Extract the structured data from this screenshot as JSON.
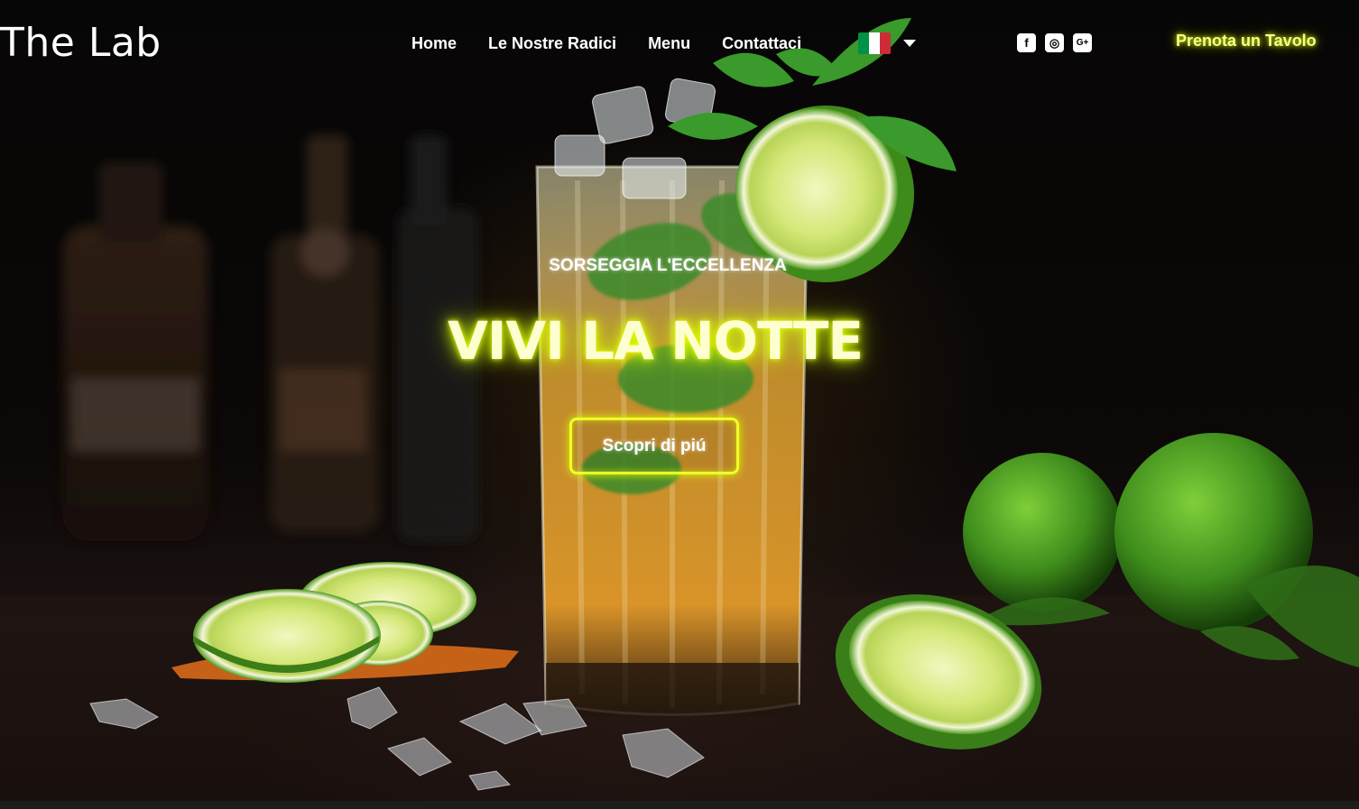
{
  "header": {
    "logo": "The Lab",
    "nav": [
      "Home",
      "Le Nostre Radici",
      "Menu",
      "Contattaci"
    ],
    "language": {
      "flag": "italy-flag-icon",
      "colors": [
        "#009246",
        "#ffffff",
        "#ce2b37"
      ]
    },
    "socials": [
      {
        "name": "facebook-icon",
        "glyph": "f"
      },
      {
        "name": "instagram-icon",
        "glyph": "◎"
      },
      {
        "name": "google-plus-icon",
        "glyph": "G+"
      }
    ],
    "book_label": "Prenota un Tavolo"
  },
  "hero": {
    "subtitle": "SORSEGGIA L'ECCELLENZA",
    "title": "VIVI LA NOTTE",
    "cta_label": "Scopri di piú"
  },
  "theme": {
    "accent": "#e8ff00",
    "background": "#050404"
  }
}
